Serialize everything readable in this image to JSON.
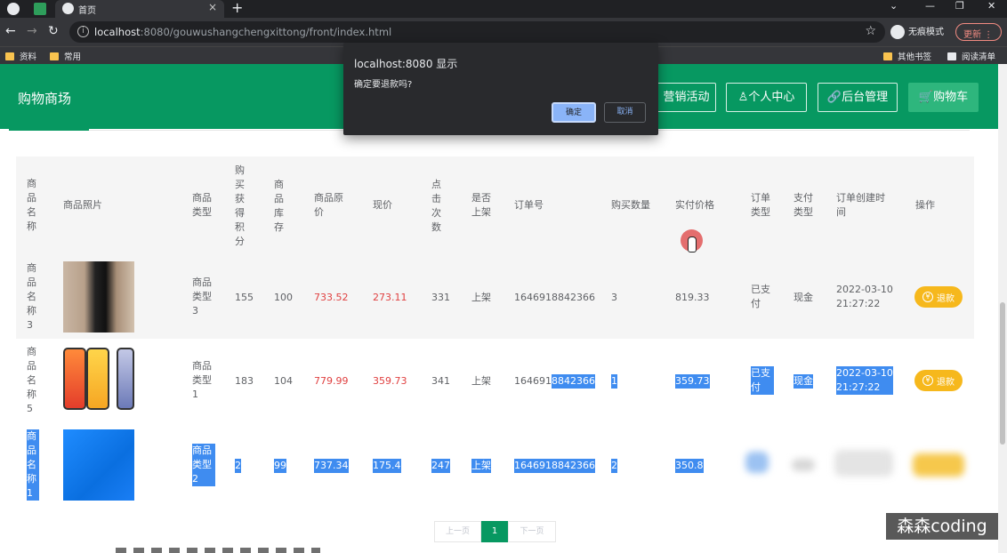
{
  "browser": {
    "tab_title": "首页",
    "url_host": "localhost",
    "url_rest": ":8080/gouwushangchengxittong/front/index.html",
    "incognito_label": "无痕模式",
    "update_label": "更新",
    "bookmarks": [
      "资料",
      "常用"
    ],
    "bookmarks_right": [
      "其他书签",
      "阅读清单"
    ]
  },
  "header": {
    "site_title": "购物商场",
    "nav": [
      "营销活动",
      "个人中心",
      "后台管理",
      "购物车"
    ]
  },
  "dialog": {
    "title": "localhost:8080 显示",
    "message": "确定要退款吗?",
    "ok_label": "确定",
    "cancel_label": "取消"
  },
  "table": {
    "columns": [
      "商品名称",
      "商品照片",
      "商品类型",
      "购买获得积分",
      "商品库存",
      "商品原价",
      "现价",
      "点击次数",
      "是否上架",
      "订单号",
      "购买数量",
      "实付价格",
      "订单类型",
      "支付类型",
      "订单创建时间",
      "操作"
    ],
    "rows": [
      {
        "name": "商品名称3",
        "type": "商品类型3",
        "points": "155",
        "stock": "100",
        "orig_price": "733.52",
        "price": "273.11",
        "clicks": "331",
        "on_shelf": "上架",
        "order_no": "1646918842366",
        "qty": "3",
        "paid": "819.33",
        "order_type": "已支付",
        "pay_type": "现金",
        "created": "2022-03-10 21:27:22",
        "action": "退款"
      },
      {
        "name": "商品名称5",
        "type": "商品类型1",
        "points": "183",
        "stock": "104",
        "orig_price": "779.99",
        "price": "359.73",
        "clicks": "341",
        "on_shelf": "上架",
        "order_no_a": "164691",
        "order_no_b": "8842366",
        "qty": "1",
        "paid": "359.73",
        "order_type": "已支付",
        "pay_type": "现金",
        "created": "2022-03-10 21:27:22",
        "action": "退款"
      },
      {
        "name": "商品名称1",
        "type": "商品类型2",
        "points": "2",
        "stock": "99",
        "orig_price": "737.34",
        "price": "175.4",
        "clicks": "247",
        "on_shelf": "上架",
        "order_no": "1646918842366",
        "qty": "2",
        "paid": "350.8"
      }
    ]
  },
  "pagination": {
    "prev": "上一页",
    "current": "1",
    "next": "下一页"
  },
  "watermark": "森森coding",
  "colors": {
    "header_green": "#079861",
    "refund_yellow": "#f6b81c",
    "selection_blue": "#3f8cf0",
    "price_red": "#e04141"
  }
}
